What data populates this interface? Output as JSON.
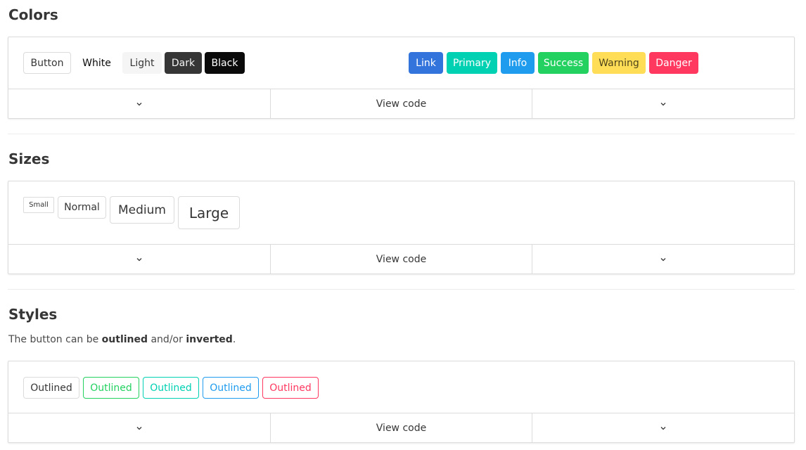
{
  "colors": {
    "title": "Colors",
    "buttons": {
      "button": "Button",
      "white": "White",
      "light": "Light",
      "dark": "Dark",
      "black": "Black",
      "link": "Link",
      "primary": "Primary",
      "info": "Info",
      "success": "Success",
      "warning": "Warning",
      "danger": "Danger"
    },
    "view_code": "View code"
  },
  "sizes": {
    "title": "Sizes",
    "buttons": {
      "small": "Small",
      "normal": "Normal",
      "medium": "Medium",
      "large": "Large"
    },
    "view_code": "View code"
  },
  "styles": {
    "title": "Styles",
    "description": {
      "prefix": "The button can be ",
      "bold1": "outlined",
      "middle": " and/or ",
      "bold2": "inverted",
      "suffix": "."
    },
    "buttons": {
      "outlined_default": "Outlined",
      "outlined_success": "Outlined",
      "outlined_primary": "Outlined",
      "outlined_info": "Outlined",
      "outlined_danger": "Outlined"
    },
    "view_code": "View code"
  },
  "icons": {
    "footer_left": "chevron-down-icon",
    "footer_right": "chevron-down-icon"
  },
  "palette": {
    "link": "#3273dc",
    "primary": "#00d1b2",
    "info": "#209cee",
    "success": "#23d160",
    "warning": "#ffdd57",
    "danger": "#ff3860",
    "dark": "#363636",
    "black": "#0a0a0a",
    "light": "#f5f5f5"
  }
}
